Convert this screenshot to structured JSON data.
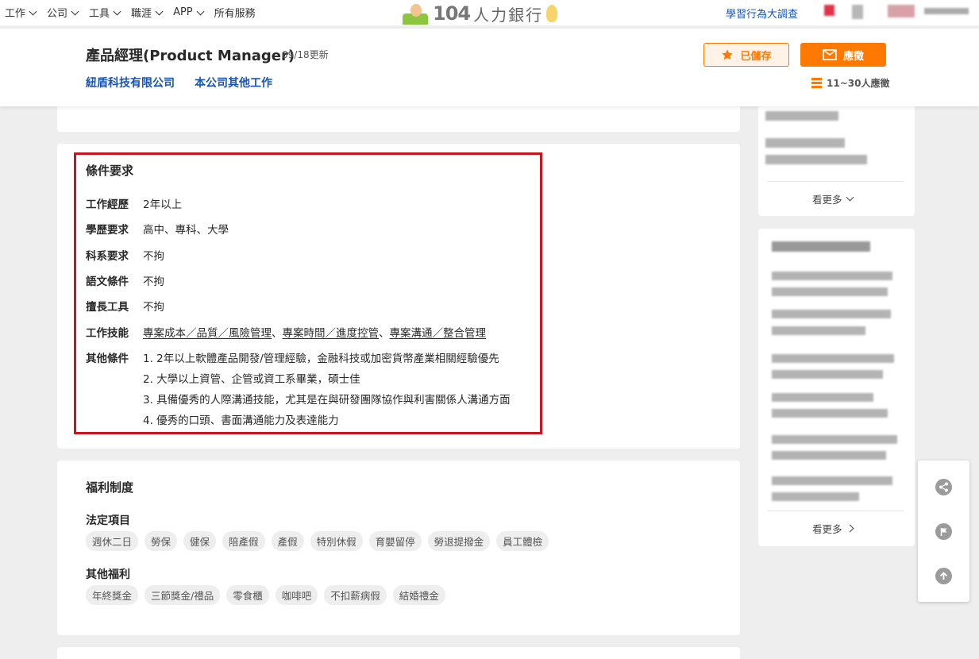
{
  "nav": {
    "items": [
      "工作",
      "公司",
      "工具",
      "職涯",
      "APP"
    ],
    "all_services": "所有服務",
    "logo_number": "104",
    "logo_text": "人力銀行",
    "survey_link": "學習行為大調查"
  },
  "job": {
    "title": "產品經理(Product Manager)",
    "updated": "09/18更新",
    "company": "紐盾科技有限公司",
    "other_jobs": "本公司其他工作",
    "saved_label": "已儲存",
    "apply_label": "應徵",
    "applicants": "11~30人應徵"
  },
  "requirements": {
    "title": "條件要求",
    "rows": [
      {
        "label": "工作經歷",
        "value": "2年以上"
      },
      {
        "label": "學歷要求",
        "value": "高中、專科、大學"
      },
      {
        "label": "科系要求",
        "value": "不拘"
      },
      {
        "label": "語文條件",
        "value": "不拘"
      },
      {
        "label": "擅長工具",
        "value": "不拘"
      }
    ],
    "skills_label": "工作技能",
    "skills": [
      "專案成本",
      "品質",
      "風險管理",
      "專案時間",
      "進度控管",
      "專案溝通",
      "整合管理"
    ],
    "other_label": "其他條件",
    "other": [
      "1. 2年以上軟體產品開發/管理經驗，金融科技或加密貨幣產業相關經驗優先",
      "2. 大學以上資管、企管或資工系畢業，碩士佳",
      "3. 具備優秀的人際溝通技能，尤其是在與研發團隊協作與利害關係人溝通方面",
      "4. 優秀的口頭、書面溝通能力及表達能力"
    ]
  },
  "benefits": {
    "title": "福利制度",
    "legal_title": "法定項目",
    "legal": [
      "週休二日",
      "勞保",
      "健保",
      "陪產假",
      "產假",
      "特別休假",
      "育嬰留停",
      "勞退提撥金",
      "員工體檢"
    ],
    "other_title": "其他福利",
    "other": [
      "年終獎金",
      "三節獎金/禮品",
      "零食櫃",
      "咖啡吧",
      "不扣薪病假",
      "結婚禮金"
    ]
  },
  "sidebar": {
    "more_label_1": "看更多",
    "more_label_2": "看更多"
  },
  "floating": {
    "icons": [
      "share-icon",
      "report-flag-icon",
      "back-to-top-icon"
    ]
  },
  "colors": {
    "brand_orange": "#ff7800",
    "link_blue": "#1654b9",
    "highlight_red": "#c9151e"
  }
}
